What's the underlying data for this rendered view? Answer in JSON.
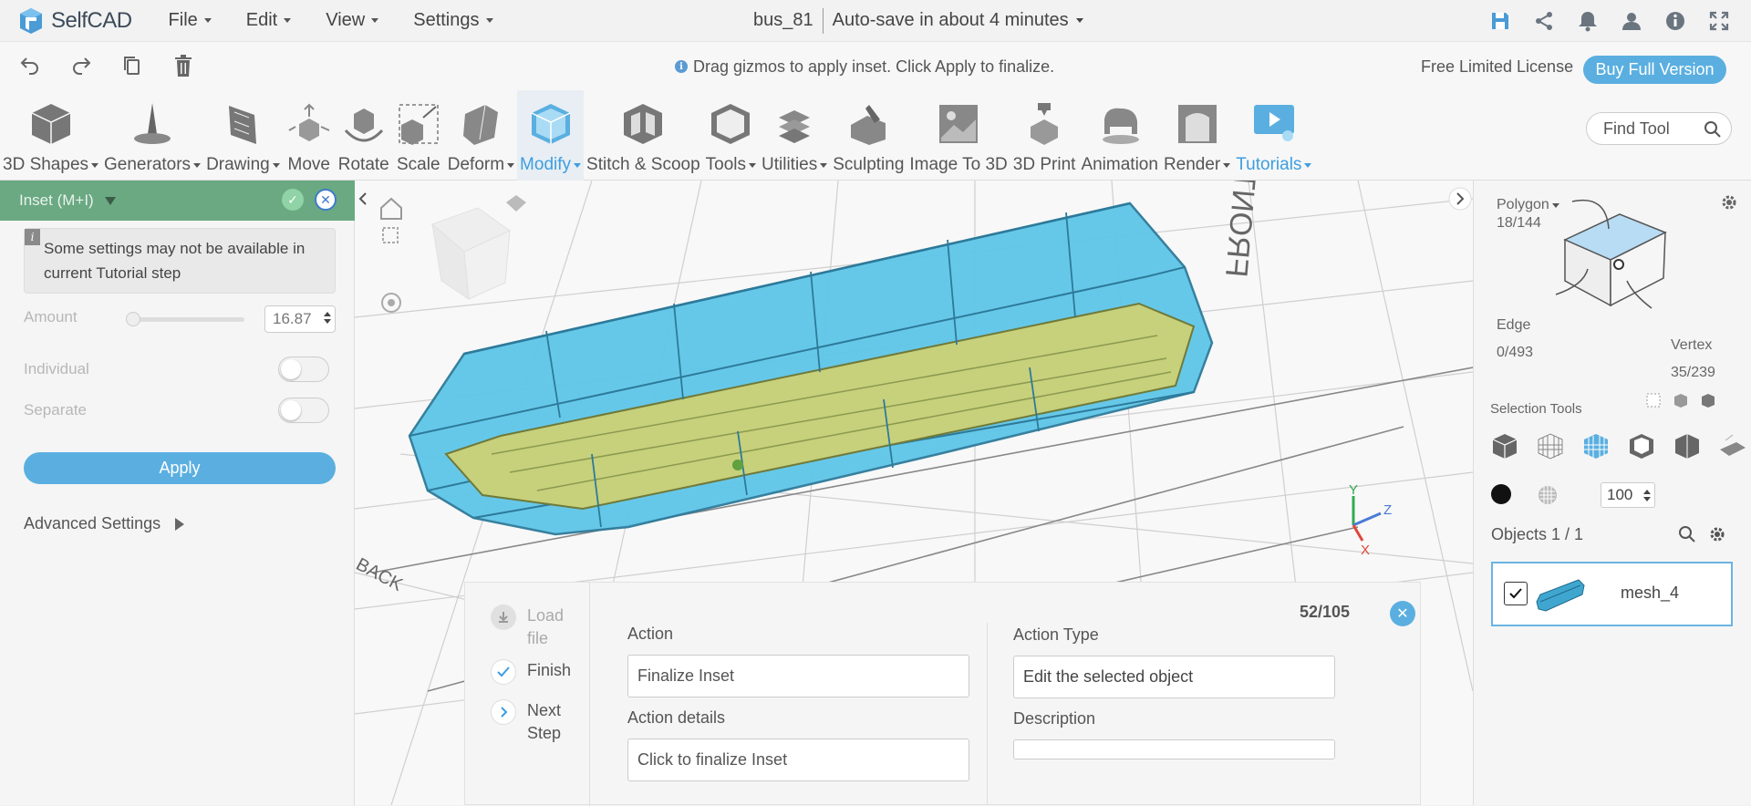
{
  "app": {
    "brand": "SelfCAD"
  },
  "menu": {
    "file": "File",
    "edit": "Edit",
    "view": "View",
    "settings": "Settings"
  },
  "project": {
    "name": "bus_81",
    "autosave": "Auto-save in about 4 minutes"
  },
  "hint": {
    "text": "Drag gizmos to apply inset. Click Apply to finalize."
  },
  "license": {
    "text": "Free Limited License",
    "buy": "Buy Full Version"
  },
  "toolbar": {
    "items": [
      {
        "label": "3D Shapes",
        "icon": "cube-icon",
        "dropdown": true
      },
      {
        "label": "Generators",
        "icon": "generators-icon",
        "dropdown": true
      },
      {
        "label": "Drawing",
        "icon": "drawing-icon",
        "dropdown": true
      },
      {
        "label": "Move",
        "icon": "move-icon",
        "dropdown": false
      },
      {
        "label": "Rotate",
        "icon": "rotate-icon",
        "dropdown": false
      },
      {
        "label": "Scale",
        "icon": "scale-icon",
        "dropdown": false
      },
      {
        "label": "Deform",
        "icon": "deform-icon",
        "dropdown": true
      },
      {
        "label": "Modify",
        "icon": "modify-icon",
        "dropdown": true
      },
      {
        "label": "Stitch & Scoop",
        "icon": "stitch-scoop-icon",
        "dropdown": false
      },
      {
        "label": "Tools",
        "icon": "tools-icon",
        "dropdown": true
      },
      {
        "label": "Utilities",
        "icon": "utilities-icon",
        "dropdown": true
      },
      {
        "label": "Sculpting",
        "icon": "sculpting-icon",
        "dropdown": false
      },
      {
        "label": "Image To 3D",
        "icon": "image-to-3d-icon",
        "dropdown": false
      },
      {
        "label": "3D Print",
        "icon": "3d-print-icon",
        "dropdown": false
      },
      {
        "label": "Animation",
        "icon": "animation-icon",
        "dropdown": false
      },
      {
        "label": "Render",
        "icon": "render-icon",
        "dropdown": true
      },
      {
        "label": "Tutorials",
        "icon": "tutorials-icon",
        "dropdown": true
      }
    ],
    "find_placeholder": "Find Tool"
  },
  "inset_panel": {
    "title": "Inset (M+I)",
    "note": "Some settings may not be available in current Tutorial step",
    "amount_label": "Amount",
    "amount_value": "16.87",
    "amount_fraction": 0.0,
    "individual_label": "Individual",
    "separate_label": "Separate",
    "apply": "Apply",
    "advanced": "Advanced Settings"
  },
  "viewport": {
    "cube_face": "FRONT",
    "front_label": "FRONT",
    "back_label": "BACK",
    "axis_y": "Y",
    "axis_z": "Z",
    "axis_x": "X"
  },
  "selection": {
    "polygon_label": "Polygon",
    "polygon_count": "18/144",
    "edge_label": "Edge",
    "edge_count": "0/493",
    "vertex_label": "Vertex",
    "vertex_count": "35/239",
    "tools_label": "Selection Tools",
    "opacity_value": "100"
  },
  "objects": {
    "title": "Objects 1 / 1",
    "items": [
      {
        "name": "mesh_4",
        "checked": true
      }
    ]
  },
  "tutorial": {
    "steps": [
      {
        "label": "Load file",
        "state": "disabled"
      },
      {
        "label": "Finish",
        "state": "done"
      },
      {
        "label": "Next Step",
        "state": "next"
      }
    ],
    "count": "52/105",
    "action_label": "Action",
    "action_value": "Finalize Inset",
    "details_label": "Action details",
    "details_value": "Click to finalize Inset",
    "type_label": "Action Type",
    "type_value": "Edit the selected object",
    "description_label": "Description",
    "description_value": ""
  },
  "colors": {
    "accent": "#5aafe0",
    "panel_header": "#6aa982",
    "mesh": "#5fc6e8",
    "inset_face": "#c7d07a"
  }
}
